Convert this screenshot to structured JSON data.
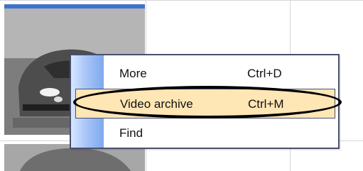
{
  "context_menu": {
    "items": [
      {
        "label": "More",
        "shortcut": "Ctrl+D"
      },
      {
        "label": "Video archive",
        "shortcut": "Ctrl+M"
      },
      {
        "label": "Find",
        "shortcut": ""
      }
    ],
    "selected_index": 1
  },
  "colors": {
    "selected_tile_border": "#3f73c8",
    "menu_highlight": "#ffe6b5",
    "menu_border": "#4a4f6f"
  }
}
